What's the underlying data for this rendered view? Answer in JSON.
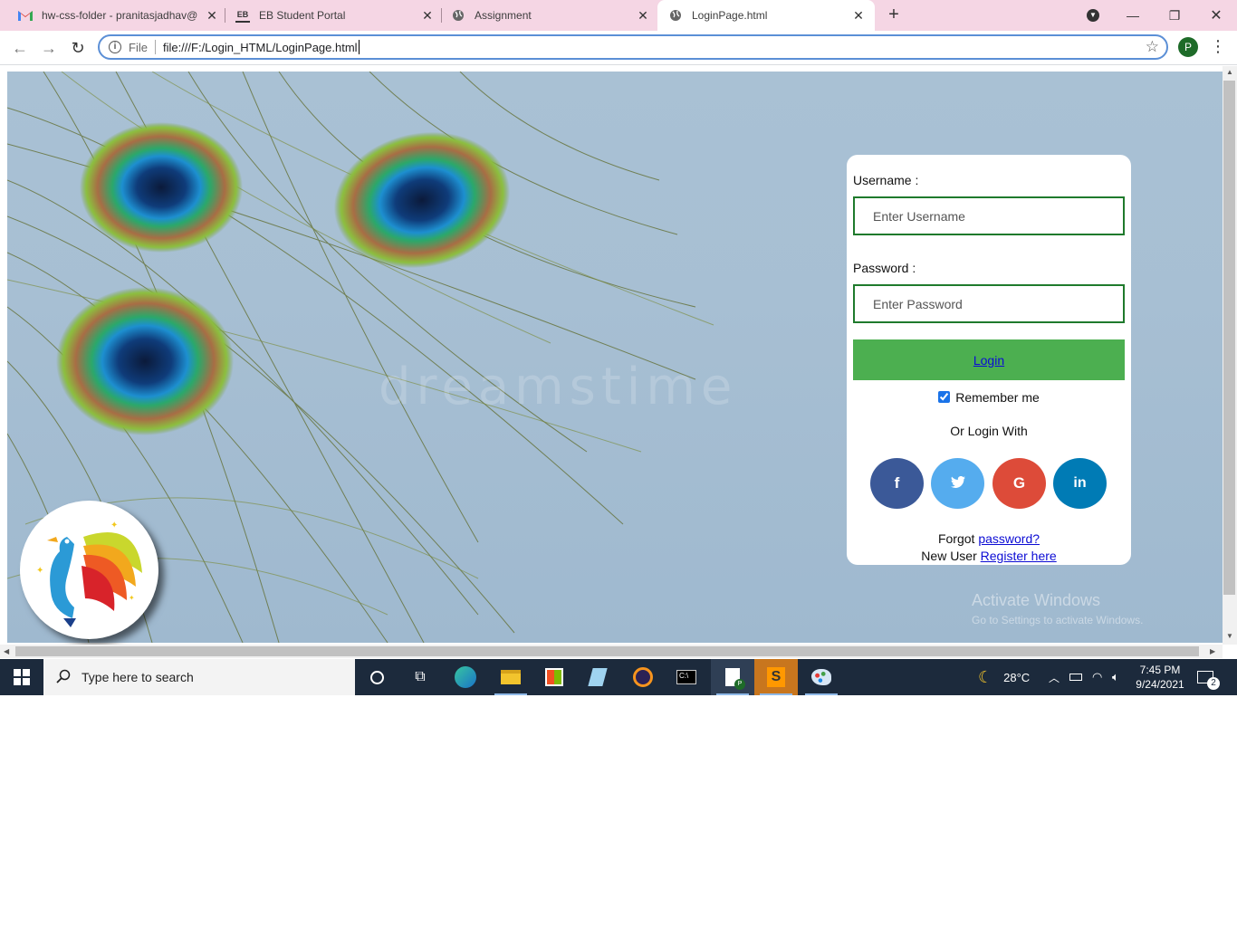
{
  "browser": {
    "tabs": [
      {
        "title": "hw-css-folder - pranitasjadhav@",
        "icon": "gmail-icon"
      },
      {
        "title": "EB Student Portal",
        "icon": "eb-icon"
      },
      {
        "title": "Assignment",
        "icon": "globe-icon"
      },
      {
        "title": "LoginPage.html",
        "icon": "globe-icon",
        "active": true
      }
    ],
    "address": {
      "scheme": "File",
      "url": "file:///F:/Login_HTML/LoginPage.html"
    },
    "profile_initial": "P"
  },
  "page": {
    "watermark": "dreamstime",
    "login": {
      "username_label": "Username :",
      "username_placeholder": "Enter Username",
      "password_label": "Password :",
      "password_placeholder": "Enter Password",
      "login_button": "Login",
      "remember_me": "Remember me",
      "remember_checked": true,
      "or_login_with": "Or Login With",
      "social": [
        {
          "label": "f",
          "icon": "facebook-icon",
          "color": "#3b5998"
        },
        {
          "label": "t",
          "icon": "twitter-icon",
          "color": "#55acee"
        },
        {
          "label": "G",
          "icon": "google-icon",
          "color": "#dd4b39"
        },
        {
          "label": "in",
          "icon": "linkedin-icon",
          "color": "#007bb5"
        }
      ],
      "forgot_prefix": "Forgot",
      "forgot_link": "password?",
      "new_user_prefix": "New User",
      "register_link": "Register here"
    },
    "activate_windows": {
      "title": "Activate Windows",
      "subtitle": "Go to Settings to activate Windows."
    }
  },
  "taskbar": {
    "search_placeholder": "Type here to search",
    "weather": "28°C",
    "time": "7:45 PM",
    "date": "9/24/2021",
    "notification_count": "2"
  },
  "colors": {
    "accent_green": "#4caf50",
    "input_border": "#1f7a2c",
    "tabstrip": "#f5d6e4"
  }
}
